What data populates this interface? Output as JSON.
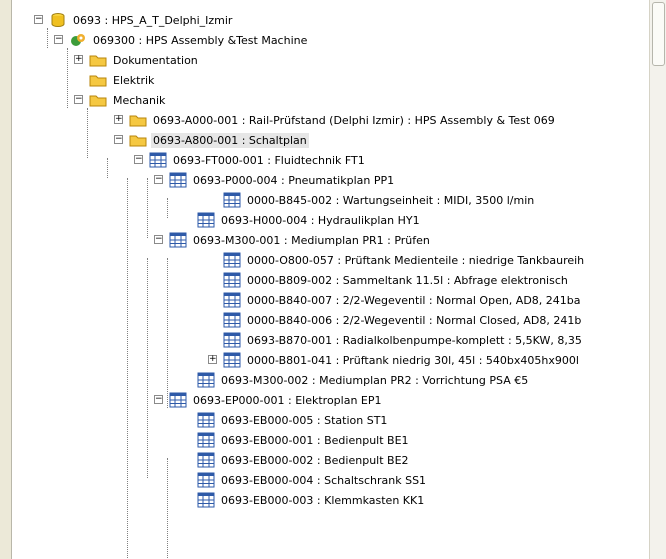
{
  "tree": {
    "items": [
      {
        "label": "0693 : HPS_A_T_Delphi_Izmir",
        "icon": "database-icon",
        "expanded": true
      },
      {
        "label": "069300 : HPS Assembly &Test Machine",
        "icon": "gear-icon",
        "expanded": true
      },
      {
        "label": "Dokumentation",
        "icon": "folder-icon",
        "expanded": false
      },
      {
        "label": "Elektrik",
        "icon": "folder-icon"
      },
      {
        "label": "Mechanik",
        "icon": "folder-icon",
        "expanded": true
      },
      {
        "label": "0693-A000-001 : Rail-Prüfstand (Delphi Izmir) : HPS Assembly & Test 069",
        "icon": "folder-icon",
        "expanded": false
      },
      {
        "label": "0693-A800-001 : Schaltplan",
        "icon": "folder-icon",
        "expanded": true,
        "selected": true
      },
      {
        "label": "0693-FT000-001 : Fluidtechnik  FT1",
        "icon": "table-icon",
        "expanded": true
      },
      {
        "label": "0693-P000-004 : Pneumatikplan  PP1",
        "icon": "table-icon",
        "expanded": true
      },
      {
        "label": "0000-B845-002 : Wartungseinheit : MIDI, 3500 l/min",
        "icon": "table-icon"
      },
      {
        "label": "0693-H000-004 : Hydraulikplan  HY1",
        "icon": "table-icon"
      },
      {
        "label": "0693-M300-001 : Mediumplan  PR1 : Prüfen",
        "icon": "table-icon",
        "expanded": true
      },
      {
        "label": "0000-O800-057 : Prüftank Medienteile : niedrige Tankbaureih",
        "icon": "table-icon"
      },
      {
        "label": "0000-B809-002 : Sammeltank  11.5l : Abfrage elektronisch",
        "icon": "table-icon"
      },
      {
        "label": "0000-B840-007 : 2/2-Wegeventil : Normal Open, AD8, 241ba",
        "icon": "table-icon"
      },
      {
        "label": "0000-B840-006 : 2/2-Wegeventil : Normal Closed, AD8, 241b",
        "icon": "table-icon"
      },
      {
        "label": "0693-B870-001 : Radialkolbenpumpe-komplett : 5,5KW, 8,35",
        "icon": "table-icon"
      },
      {
        "label": "0000-B801-041 : Prüftank  niedrig 30l, 45l : 540bx405hx900l",
        "icon": "table-icon",
        "expanded": false
      },
      {
        "label": "0693-M300-002 : Mediumplan  PR2 : Vorrichtung PSA €5",
        "icon": "table-icon"
      },
      {
        "label": "0693-EP000-001 : Elektroplan  EP1",
        "icon": "table-icon",
        "expanded": true
      },
      {
        "label": "0693-EB000-005 : Station  ST1",
        "icon": "table-icon"
      },
      {
        "label": "0693-EB000-001 : Bedienpult  BE1",
        "icon": "table-icon"
      },
      {
        "label": "0693-EB000-002 : Bedienpult  BE2",
        "icon": "table-icon"
      },
      {
        "label": "0693-EB000-004 : Schaltschrank  SS1",
        "icon": "table-icon"
      },
      {
        "label": "0693-EB000-003 : Klemmkasten  KK1",
        "icon": "table-icon"
      }
    ]
  },
  "colors": {
    "background": "#ffffff",
    "selection": "#e6e6e6",
    "folder": "#f5c842",
    "table_header": "#2e5aa8"
  }
}
